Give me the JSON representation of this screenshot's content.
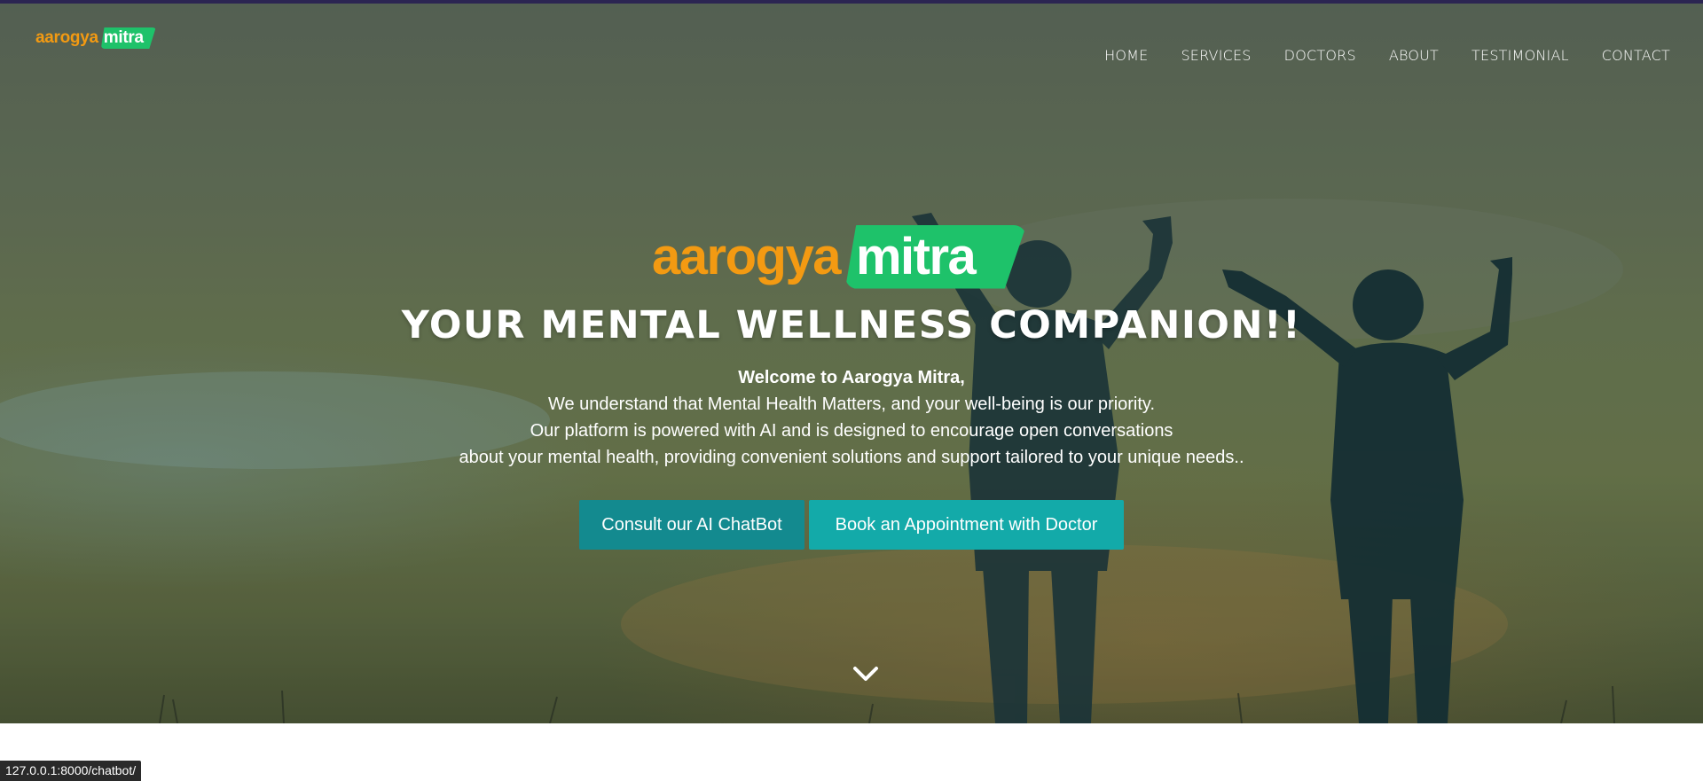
{
  "brand": {
    "word_a": "aarogya",
    "word_b": "mitra",
    "color_a": "#f39a12",
    "color_b": "#1ec26a"
  },
  "nav": {
    "items": [
      {
        "label": "HOME"
      },
      {
        "label": "SERVICES"
      },
      {
        "label": "DOCTORS"
      },
      {
        "label": "ABOUT"
      },
      {
        "label": "TESTIMONIAL"
      },
      {
        "label": "CONTACT"
      }
    ]
  },
  "hero": {
    "title": "YOUR MENTAL WELLNESS COMPANION!!",
    "welcome": "Welcome to Aarogya Mitra,",
    "lines": [
      "We understand that Mental Health Matters, and your well-being is our priority.",
      "Our platform is powered with AI and is designed to encourage open conversations",
      "about your mental health, providing convenient solutions and support tailored to your unique needs.."
    ],
    "buttons": {
      "chatbot": "Consult our AI ChatBot",
      "appointment": "Book an Appointment with Doctor"
    },
    "scroll_icon": "chevron-down-icon"
  },
  "status_bar": {
    "url": "127.0.0.1:8000/chatbot/"
  },
  "colors": {
    "top_strip": "#2b2552",
    "button_primary": "#138a8f",
    "button_secondary": "#13aaa9"
  }
}
